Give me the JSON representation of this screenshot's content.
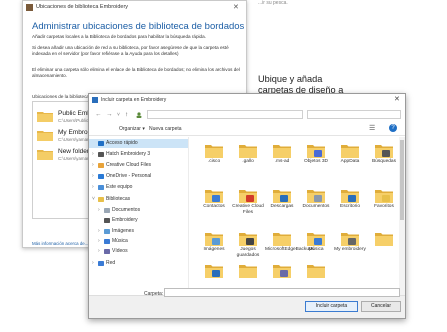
{
  "top_clip": "...ir su pesca.",
  "bg_dialog": {
    "title": "Ubicaciones de biblioteca Embroidery",
    "heading": "Administrar ubicaciones de biblioteca de bordados",
    "paragraphs": [
      "Añadir carpetas locales a la Biblioteca de bordados para habilitar la búsqueda rápida.",
      "Si desea añadir una ubicación de red a su biblioteca, por favor asegúrese de que la carpeta esté indexada en el servidor (por favor refiérase a la Ayuda para los detalles)",
      "El eliminar una carpeta sólo elimina el enlace de la Biblioteca de bordados; no elimina los archivos del almacenamiento."
    ],
    "section_label": "Ubicaciones de la biblioteca",
    "items": [
      {
        "name": "Public Embro",
        "path": "C:\\Users\\Public\\..."
      },
      {
        "name": "My Embroid",
        "path": "C:\\Users\\yamam..."
      },
      {
        "name": "New folder",
        "path": "C:\\Users\\yaman..."
      }
    ],
    "link": "Más información acerca de..."
  },
  "callout": "Ubique y añada carpetas de diseño a su biblioteca",
  "main_dialog": {
    "title": "Incluir carpeta en Embroidery",
    "toolbar": {
      "organize": "Organizar ▾",
      "new_folder": "Nueva carpeta"
    },
    "nav": [
      {
        "label": "Acceso rápido",
        "indent": 0,
        "chev": "",
        "highlight": true,
        "color": "#1f6fc5"
      },
      {
        "label": "Hatch Embroidery 3",
        "indent": 0,
        "chev": "›",
        "highlight": false,
        "color": "#555555"
      },
      {
        "label": "Creative Cloud Files",
        "indent": 0,
        "chev": "›",
        "highlight": false,
        "color": "#e8a33a"
      },
      {
        "label": "OneDrive - Personal",
        "indent": 0,
        "chev": "›",
        "highlight": false,
        "color": "#2a7ad6"
      },
      {
        "label": "Este equipo",
        "indent": 0,
        "chev": "›",
        "highlight": false,
        "color": "#4a8fd9"
      },
      {
        "label": "Bibliotecas",
        "indent": 0,
        "chev": "˅",
        "highlight": false,
        "color": "#e8c04a"
      },
      {
        "label": "Documentos",
        "indent": 1,
        "chev": "›",
        "highlight": false,
        "color": "#9aa7b5"
      },
      {
        "label": "Embroidery",
        "indent": 1,
        "chev": "",
        "highlight": false,
        "color": "#555555"
      },
      {
        "label": "Imágenes",
        "indent": 1,
        "chev": "›",
        "highlight": false,
        "color": "#5b9bd5"
      },
      {
        "label": "Música",
        "indent": 1,
        "chev": "›",
        "highlight": false,
        "color": "#3a7bd5"
      },
      {
        "label": "Vídeos",
        "indent": 1,
        "chev": "›",
        "highlight": false,
        "color": "#6a6aa8"
      },
      {
        "label": "Red",
        "indent": 0,
        "chev": "›",
        "highlight": false,
        "color": "#3a7bd5"
      }
    ],
    "tiles": [
      {
        "label": ".cisco",
        "badge": ""
      },
      {
        "label": ".gallo",
        "badge": ""
      },
      {
        "label": ".ms-ad",
        "badge": ""
      },
      {
        "label": "Objetos 3D",
        "badge": "3d"
      },
      {
        "label": "AppData",
        "badge": ""
      },
      {
        "label": "Búsquedas",
        "badge": "search"
      },
      {
        "label": "Contactos",
        "badge": "contact"
      },
      {
        "label": "Creative Cloud Files",
        "badge": "cc"
      },
      {
        "label": "Descargas",
        "badge": "down"
      },
      {
        "label": "Documentos",
        "badge": "doc"
      },
      {
        "label": "Escritorio",
        "badge": "desk"
      },
      {
        "label": "Favoritos",
        "badge": "star"
      },
      {
        "label": "Imágenes",
        "badge": "img"
      },
      {
        "label": "Juegos guardados",
        "badge": "game"
      },
      {
        "label": "MicrosoftEdgeBackups",
        "badge": ""
      },
      {
        "label": "Música",
        "badge": "music"
      },
      {
        "label": "My embroidery",
        "badge": "emb"
      },
      {
        "label": "",
        "badge": ""
      },
      {
        "label": "",
        "badge": "obj"
      },
      {
        "label": "",
        "badge": ""
      },
      {
        "label": "",
        "badge": "vid"
      },
      {
        "label": "",
        "badge": ""
      }
    ],
    "footer": {
      "folder_label": "Carpeta:",
      "folder_value": "",
      "ok": "Incluir carpeta",
      "cancel": "Cancelar"
    }
  }
}
